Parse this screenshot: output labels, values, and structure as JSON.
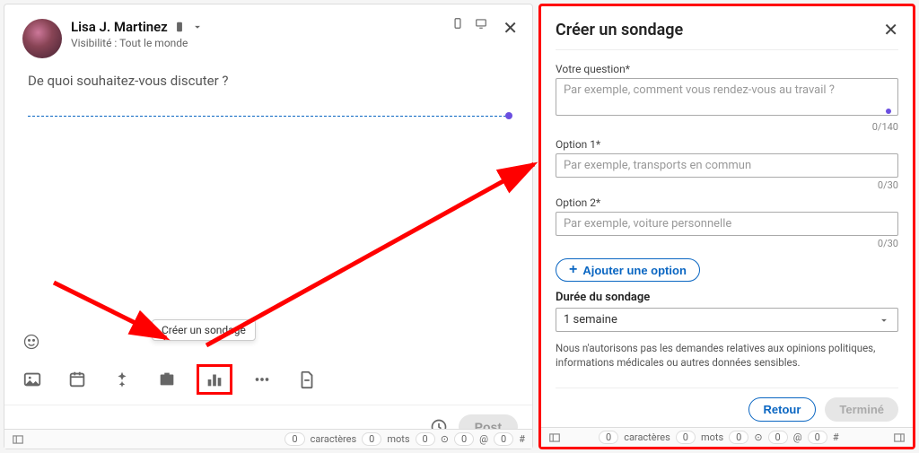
{
  "compose": {
    "user_name": "Lisa J. Martinez",
    "visibility_prefix": "Visibilité :",
    "visibility_value": "Tout le monde",
    "prompt": "De quoi souhaitez-vous discuter ?",
    "tooltip": "Créer un sondage",
    "post_label": "Post",
    "icons": {
      "image": "image-icon",
      "calendar": "calendar-icon",
      "starburst": "celebrate-icon",
      "briefcase": "job-icon",
      "poll": "poll-icon",
      "ellipsis": "more-icon",
      "document": "document-icon"
    }
  },
  "poll": {
    "title": "Créer un sondage",
    "question_label": "Votre question*",
    "question_placeholder": "Par exemple, comment vous rendez-vous au travail ?",
    "question_counter": "0/140",
    "option1_label": "Option 1*",
    "option1_placeholder": "Par exemple, transports en commun",
    "option1_counter": "0/30",
    "option2_label": "Option 2*",
    "option2_placeholder": "Par exemple, voiture personnelle",
    "option2_counter": "0/30",
    "add_option": "Ajouter une option",
    "duration_label": "Durée du sondage",
    "duration_value": "1 semaine",
    "disclaimer": "Nous n'autorisons pas les demandes relatives aux opinions politiques, informations médicales ou autres données sensibles.",
    "back": "Retour",
    "done": "Terminé"
  },
  "status": {
    "chars_count": "0",
    "chars_label": "caractères",
    "words_count": "0",
    "words_label": "mots",
    "zero": "0",
    "at": "@",
    "hash": "#"
  }
}
